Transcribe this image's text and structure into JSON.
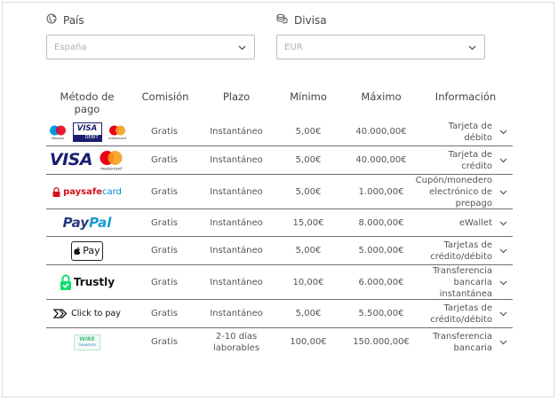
{
  "country": {
    "label": "País",
    "value": "España",
    "icon": "globe-icon"
  },
  "currency": {
    "label": "Divisa",
    "value": "EUR",
    "icon": "coins-icon"
  },
  "table": {
    "headers": {
      "method": "Método de pago",
      "commission": "Comisión",
      "term": "Plazo",
      "min": "Mínimo",
      "max": "Máximo",
      "info": "Información"
    },
    "rows": [
      {
        "logo": "maestro-visa-debit-mastercard-logo",
        "maestro_text": "Maestro",
        "visa_text": "VISA",
        "debit_text": "DEBIT",
        "mc_text": "mastercard",
        "commission": "Gratis",
        "term": "Instantáneo",
        "min": "5,00€",
        "max": "40.000,00€",
        "info": "Tarjeta de débito"
      },
      {
        "logo": "visa-mastercard-logo",
        "visa_text": "VISA",
        "mc_text": "mastercard",
        "commission": "Gratis",
        "term": "Instantáneo",
        "min": "5,00€",
        "max": "40.000,00€",
        "info": "Tarjeta de crédito"
      },
      {
        "logo": "paysafecard-logo",
        "brand_a": "paysafe",
        "brand_b": "card",
        "commission": "Gratis",
        "term": "Instantáneo",
        "min": "5,00€",
        "max": "1.000,00€",
        "info": "Cupón/monedero electrónico de prepago"
      },
      {
        "logo": "paypal-logo",
        "brand_a": "Pay",
        "brand_b": "Pal",
        "commission": "Gratis",
        "term": "Instantáneo",
        "min": "15,00€",
        "max": "8.000,00€",
        "info": "eWallet"
      },
      {
        "logo": "apple-pay-logo",
        "brand": "Pay",
        "commission": "Gratis",
        "term": "Instantáneo",
        "min": "5,00€",
        "max": "5.000,00€",
        "info": "Tarjetas de crédito/débito"
      },
      {
        "logo": "trustly-logo",
        "brand": "Trustly",
        "commission": "Gratis",
        "term": "Instantáneo",
        "min": "10,00€",
        "max": "6.000,00€",
        "info": "Transferencia bancaria instantánea"
      },
      {
        "logo": "click-to-pay-logo",
        "brand": "Click to pay",
        "commission": "Gratis",
        "term": "Instantáneo",
        "min": "5,00€",
        "max": "5.500,00€",
        "info": "Tarjetas de crédito/débito"
      },
      {
        "logo": "wire-transfer-logo",
        "brand_a": "WIRE",
        "brand_b": "TRANSFER",
        "commission": "Gratis",
        "term": "2-10 días laborables",
        "min": "100,00€",
        "max": "150.000,00€",
        "info": "Transferencia bancaria"
      }
    ]
  },
  "colors": {
    "visa_blue": "#1a1f71",
    "mc_red": "#eb001b",
    "mc_yellow": "#f79e1b",
    "maestro_blue": "#0099df",
    "paysafe_red": "#d3121b",
    "paysafe_blue": "#008ac9",
    "paypal_dark": "#253b80",
    "paypal_light": "#179bd7",
    "trustly_green": "#0ee06e",
    "wire_green": "#3dbf7a"
  }
}
